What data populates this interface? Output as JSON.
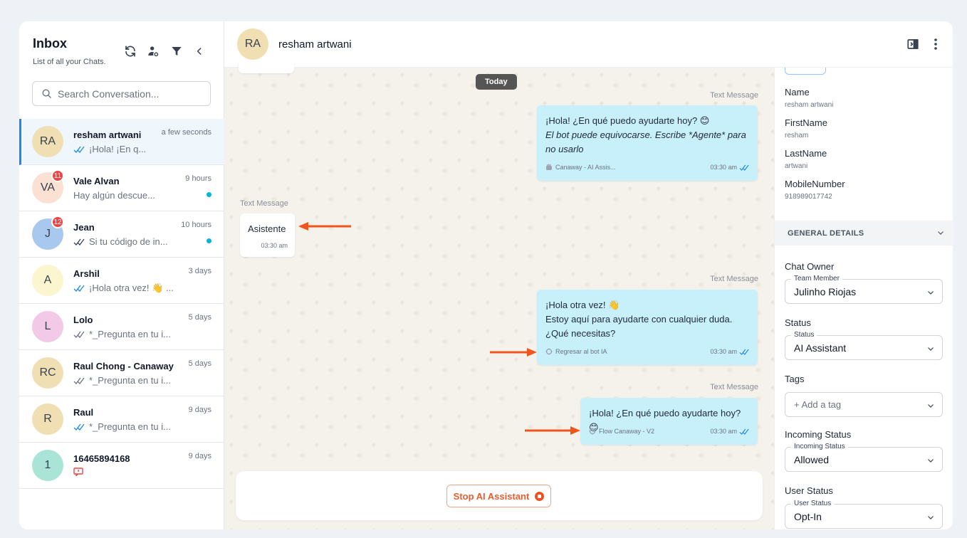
{
  "inbox": {
    "title": "Inbox",
    "subtitle": "List of all your Chats.",
    "search_placeholder": "Search Conversation..."
  },
  "conversations": [
    {
      "initials": "RA",
      "name": "resham artwani",
      "time": "a few seconds",
      "preview": "¡Hola! ¡En q...",
      "avatar_color": "#efdfb3",
      "badge": "",
      "unread_dot": false,
      "active": true,
      "tick_color": "#1e88e5"
    },
    {
      "initials": "VA",
      "name": "Vale Alvan",
      "time": "9 hours",
      "preview": "Hay algún descue...",
      "avatar_color": "#fbe0d4",
      "badge": "11",
      "unread_dot": true,
      "active": false
    },
    {
      "initials": "J",
      "name": "Jean",
      "time": "10 hours",
      "preview": "Si tu código de in...",
      "avatar_color": "#a8c8ee",
      "badge": "12",
      "unread_dot": true,
      "active": false,
      "tick_color": "#374151"
    },
    {
      "initials": "A",
      "name": "Arshil",
      "time": "3 days",
      "preview": "¡Hola otra vez! 👋 ...",
      "avatar_color": "#fbf6d0",
      "badge": "",
      "unread_dot": false,
      "active": false,
      "tick_color": "#1e88e5"
    },
    {
      "initials": "L",
      "name": "Lolo",
      "time": "5 days",
      "preview": "*_Pregunta en tu i...",
      "avatar_color": "#f2c9e6",
      "badge": "",
      "unread_dot": false,
      "active": false,
      "tick_color": "#6b7280"
    },
    {
      "initials": "RC",
      "name": "Raul Chong - Canaway",
      "time": "5 days",
      "preview": "*_Pregunta en tu i...",
      "avatar_color": "#efdfb3",
      "badge": "",
      "unread_dot": false,
      "active": false,
      "tick_color": "#6b7280"
    },
    {
      "initials": "R",
      "name": "Raul",
      "time": "9 days",
      "preview": "*_Pregunta en tu i...",
      "avatar_color": "#efdfb3",
      "badge": "",
      "unread_dot": false,
      "active": false,
      "tick_color": "#1e88e5"
    },
    {
      "initials": "1",
      "name": "16465894168",
      "time": "9 days",
      "preview": "",
      "avatar_color": "#a9e4d6",
      "badge": "",
      "unread_dot": false,
      "active": false,
      "note_icon": true
    }
  ],
  "chat": {
    "initials": "RA",
    "name": "resham artwani",
    "today": "Today",
    "messages": [
      {
        "label": "Text Message",
        "line1": "¡Hola! ¿En qué puedo ayudarte hoy? 😊",
        "line2": "El bot puede equivocarse. Escribe *Agente* para",
        "line3": "no usarlo",
        "source": "Canaway - AI Assis...",
        "time": "03:30 am"
      },
      {
        "label": "Text Message",
        "text": "Asistente",
        "time": "03:30 am"
      },
      {
        "label": "Text Message",
        "line1": "¡Hola otra vez! 👋",
        "line2": "Estoy aquí para ayudarte con cualquier duda.",
        "line3": "¿Qué necesitas?",
        "source": "Regresar al bot IA",
        "time": "03:30 am"
      },
      {
        "label": "Text Message",
        "line1": "¡Hola! ¿En qué puedo ayudarte hoy? 😊",
        "source": "Flow Canaway - V2",
        "time": "03:30 am"
      }
    ],
    "stop_label": "Stop AI Assistant",
    "arrow_color": "#f0561c"
  },
  "details": {
    "fields": [
      {
        "label": "Name",
        "value": "resham artwani"
      },
      {
        "label": "FirstName",
        "value": "resham"
      },
      {
        "label": "LastName",
        "value": "artwani"
      },
      {
        "label": "MobileNumber",
        "value": "918989017742"
      }
    ],
    "section_title": "GENERAL DETAILS",
    "chat_owner": {
      "label": "Chat Owner",
      "legend": "Team Member",
      "value": "Julinho Riojas"
    },
    "status": {
      "label": "Status",
      "legend": "Status",
      "value": "AI Assistant"
    },
    "tags": {
      "label": "Tags",
      "placeholder": "+ Add a tag"
    },
    "incoming_status": {
      "label": "Incoming Status",
      "legend": "Incoming Status",
      "value": "Allowed"
    },
    "user_status": {
      "label": "User Status",
      "legend": "User Status",
      "value": "Opt-In"
    }
  }
}
